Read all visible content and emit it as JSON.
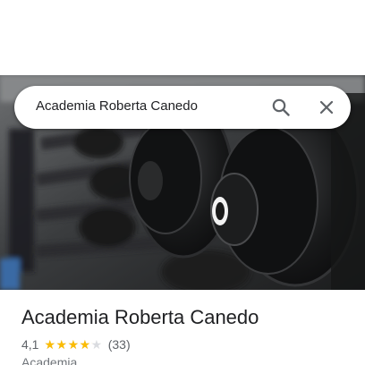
{
  "search": {
    "query": "Academia Roberta Canedo",
    "search_icon": "search-icon",
    "close_icon": "close-icon"
  },
  "hero": {
    "image": "dumbbell-rack-photo"
  },
  "place": {
    "name": "Academia Roberta Canedo",
    "rating": "4,1",
    "rating_fraction": 0.82,
    "reviews": "(33)",
    "category": "Academia"
  },
  "colors": {
    "star": "#fbbc04",
    "star_empty": "#dadce0",
    "text_primary": "#202124",
    "text_secondary": "#70757a"
  }
}
